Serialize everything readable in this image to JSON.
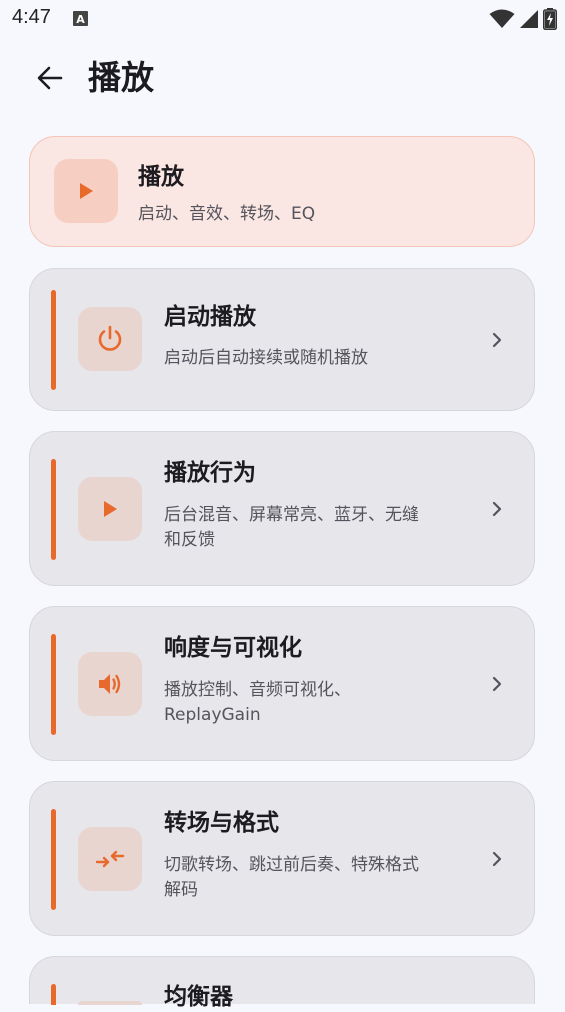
{
  "status_bar": {
    "time": "4:47",
    "notification_icon": "a-letter-icon",
    "icons": [
      "wifi-icon",
      "signal-icon",
      "battery-charging-icon"
    ]
  },
  "header": {
    "back_icon": "arrow-left-icon",
    "title": "播放"
  },
  "section_header": {
    "title": "播放",
    "subtitle": "启动、音效、转场、EQ",
    "icon": "play-icon"
  },
  "items": [
    {
      "title": "启动播放",
      "subtitle_lines": [
        "启动后自动接续或随机播放"
      ],
      "icon": "power-icon"
    },
    {
      "title": "播放行为",
      "subtitle_lines": [
        "后台混音、屏幕常亮、蓝牙、无缝",
        "和反馈"
      ],
      "icon": "play-icon"
    },
    {
      "title": "响度与可视化",
      "subtitle_lines": [
        "播放控制、音频可视化、",
        "ReplayGain"
      ],
      "icon": "volume-icon"
    },
    {
      "title": "转场与格式",
      "subtitle_lines": [
        "切歌转场、跳过前后奏、特殊格式",
        "解码"
      ],
      "icon": "transition-icon"
    },
    {
      "title": "均衡器",
      "subtitle_lines": [],
      "icon": "equalizer-icon"
    }
  ],
  "colors": {
    "accent": "#e8692c",
    "background": "#f7f8fd",
    "card": "#e6e6eb",
    "header_card": "#fae6e2"
  }
}
